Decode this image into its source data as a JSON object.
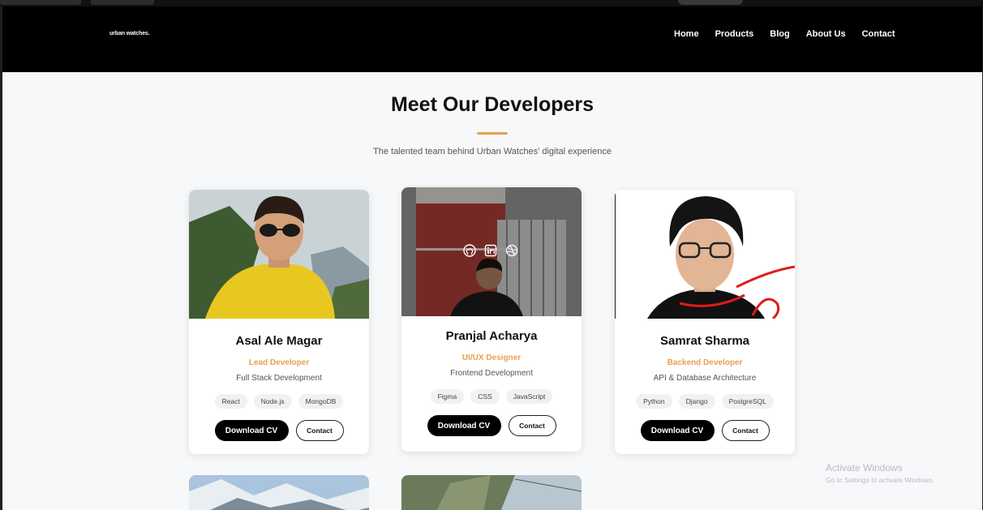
{
  "site": {
    "logo_text": "urban watches."
  },
  "nav": {
    "items": [
      "Home",
      "Products",
      "Blog",
      "About Us",
      "Contact"
    ]
  },
  "section": {
    "title": "Meet Our Developers",
    "subtitle": "The talented team behind Urban Watches' digital experience"
  },
  "developers": [
    {
      "name": "Asal Ale Magar",
      "role": "Lead Developer",
      "focus": "Full Stack Development",
      "skills": [
        "React",
        "Node.js",
        "MongoDB"
      ],
      "download_label": "Download CV",
      "contact_label": "Contact"
    },
    {
      "name": "Pranjal Acharya",
      "role": "UI/UX Designer",
      "focus": "Frontend Development",
      "skills": [
        "Figma",
        "CSS",
        "JavaScript"
      ],
      "download_label": "Download CV",
      "contact_label": "Contact"
    },
    {
      "name": "Samrat Sharma",
      "role": "Backend Developer",
      "focus": "API & Database Architecture",
      "skills": [
        "Python",
        "Django",
        "PostgreSQL"
      ],
      "download_label": "Download CV",
      "contact_label": "Contact"
    }
  ],
  "social_icons": [
    "github-icon",
    "linkedin-icon",
    "dribbble-icon"
  ],
  "watermark": {
    "title": "Activate Windows",
    "subtitle": "Go to Settings to activate Windows."
  },
  "colors": {
    "accent": "#e9a050",
    "nav_bg": "#000000",
    "page_bg": "#f7f8fa"
  }
}
